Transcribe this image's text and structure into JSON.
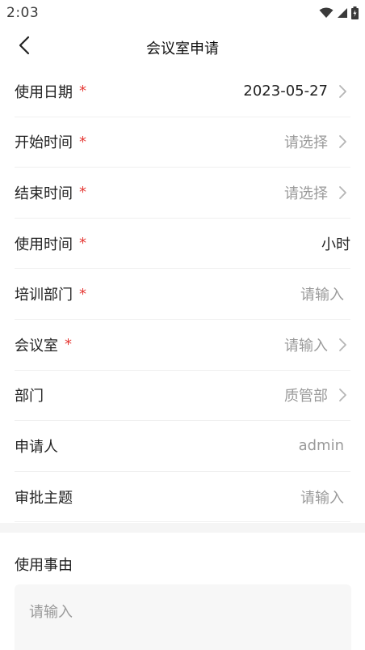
{
  "status_bar": {
    "time": "2:03",
    "icons": [
      "wifi-icon",
      "signal-icon",
      "battery-icon"
    ]
  },
  "header": {
    "title": "会议室申请",
    "back_icon": "chevron-left-icon"
  },
  "form": {
    "rows": [
      {
        "label": "使用日期",
        "required": "*",
        "value": "2023-05-27",
        "filled": true,
        "arrow": true
      },
      {
        "label": "开始时间",
        "required": "*",
        "value": "请选择",
        "filled": false,
        "arrow": true
      },
      {
        "label": "结束时间",
        "required": "*",
        "value": "请选择",
        "filled": false,
        "arrow": true
      },
      {
        "label": "使用时间",
        "required": "*",
        "value": "小时",
        "filled": true,
        "arrow": false
      },
      {
        "label": "培训部门",
        "required": "*",
        "value": "请输入",
        "filled": false,
        "arrow": false
      },
      {
        "label": "会议室",
        "required": "*",
        "value": "请输入",
        "filled": false,
        "arrow": true
      },
      {
        "label": "部门",
        "required": "",
        "value": "质管部",
        "filled": false,
        "arrow": true
      },
      {
        "label": "申请人",
        "required": "",
        "value": "admin",
        "filled": false,
        "arrow": false
      },
      {
        "label": "审批主题",
        "required": "",
        "value": "请输入",
        "filled": false,
        "arrow": false
      }
    ]
  },
  "reason": {
    "label": "使用事由",
    "placeholder": "请输入"
  },
  "colors": {
    "required": "#e53935",
    "placeholder": "#9a9a9a",
    "text": "#222222",
    "divider": "#f0f0f0",
    "input_bg": "#f7f7f7"
  }
}
